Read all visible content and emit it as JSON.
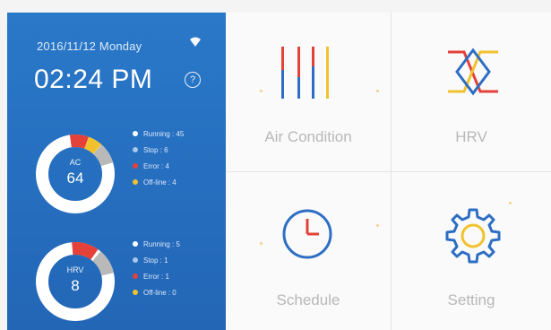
{
  "status": {
    "date": "2016/11/12  Monday",
    "time": "02:24 PM",
    "help_glyph": "?"
  },
  "ac_summary": {
    "label": "AC",
    "count": "64",
    "legend": [
      {
        "text": "Running : 45",
        "color": "#ffffff"
      },
      {
        "text": "Stop : 6",
        "color": "#aac6ec"
      },
      {
        "text": "Error : 4",
        "color": "#e4413a"
      },
      {
        "text": "Off-line : 4",
        "color": "#f2c22e"
      }
    ]
  },
  "hrv_summary": {
    "label": "HRV",
    "count": "8",
    "legend": [
      {
        "text": "Running : 5",
        "color": "#ffffff"
      },
      {
        "text": "Stop : 1",
        "color": "#aac6ec"
      },
      {
        "text": "Error : 1",
        "color": "#e4413a"
      },
      {
        "text": "Off-line : 0",
        "color": "#f2c22e"
      }
    ]
  },
  "tiles": {
    "air_condition": "Air Condition",
    "hrv": "HRV",
    "schedule": "Schedule",
    "setting": "Setting"
  },
  "colors": {
    "panel": "#2a78c9",
    "blue_icon": "#2d6ec4",
    "red": "#e4413a",
    "yellow": "#f2c22e",
    "gray": "#bdbdbd"
  }
}
